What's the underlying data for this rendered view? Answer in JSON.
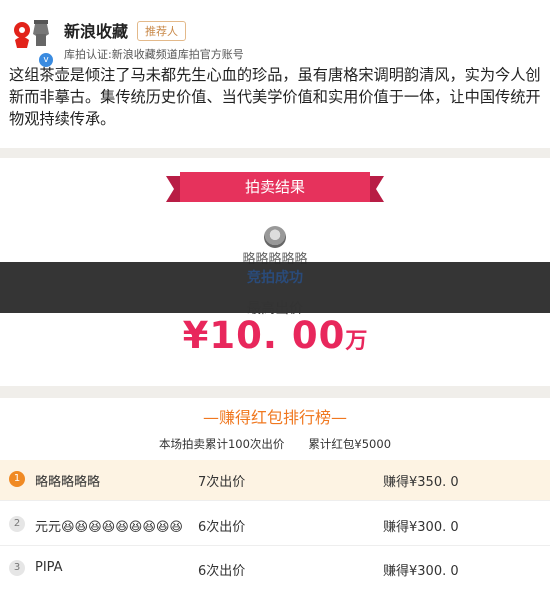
{
  "post": {
    "username": "新浪收藏",
    "tag": "推荐人",
    "cert": "库拍认证:新浪收藏频道库拍官方账号",
    "verified_glyph": "v",
    "description": "这组茶壶是倾注了马未都先生心血的珍品，虽有唐格宋调明韵清风，实为今人创新而非摹古。集传统历史价值、当代美学价值和实用价值于一体，让中国传统开物观持续传承。"
  },
  "results": {
    "ribbon": "拍卖结果",
    "winner_name": "略略略略略",
    "status": "竞拍成功",
    "highest_label": "最高出价",
    "price": "¥10. 00",
    "price_unit": "万"
  },
  "ranking": {
    "title": "—赚得红包排行榜—",
    "summary_bids": "本场拍卖累计100次出价",
    "summary_total": "累计红包¥5000",
    "rows": [
      {
        "rank": "1",
        "name": "略略略略略",
        "bids": "7次出价",
        "earn": "赚得¥350. 0"
      },
      {
        "rank": "2",
        "name": "元元😆😆😆😆😆😆😆😆😆",
        "bids": "6次出价",
        "earn": "赚得¥300. 0"
      },
      {
        "rank": "3",
        "name": "PIPA",
        "bids": "6次出价",
        "earn": "赚得¥300. 0"
      }
    ]
  },
  "colors": {
    "accent": "#e8275c",
    "orange": "#f07820",
    "ribbon": "#e6325c"
  }
}
